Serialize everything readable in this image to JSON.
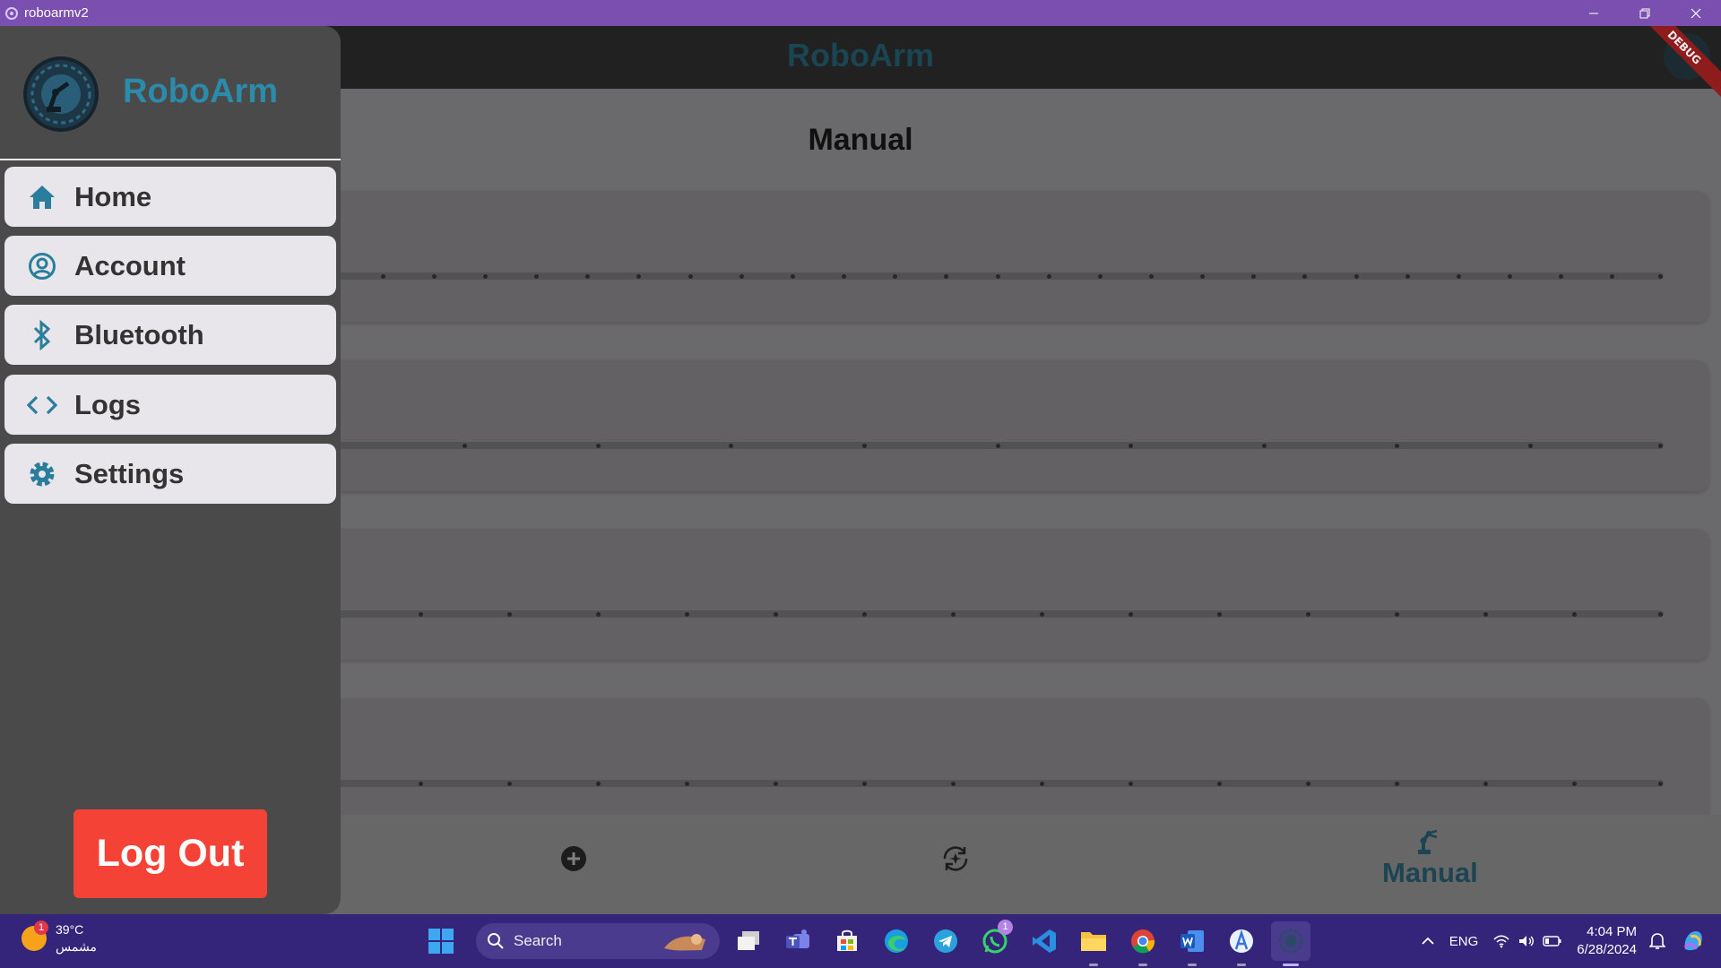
{
  "window": {
    "title": "roboarmv2"
  },
  "appbar": {
    "title": "RoboArm",
    "debug_label": "DEBUG"
  },
  "page": {
    "title": "Manual"
  },
  "sliders": [
    {
      "divisions": 26
    },
    {
      "divisions": 10
    },
    {
      "divisions": 15
    },
    {
      "divisions": 15
    }
  ],
  "bottom_nav": {
    "items": [
      {
        "icon": "add-circle-icon",
        "label": ""
      },
      {
        "icon": "rotate-icon",
        "label": ""
      },
      {
        "icon": "robot-arm-icon",
        "label": "Manual",
        "selected": true
      }
    ]
  },
  "drawer": {
    "title": "RoboArm",
    "items": [
      {
        "label": "Home",
        "icon": "home-icon"
      },
      {
        "label": "Account",
        "icon": "account-circle-icon"
      },
      {
        "label": "Bluetooth",
        "icon": "bluetooth-icon"
      },
      {
        "label": "Logs",
        "icon": "code-icon"
      },
      {
        "label": "Settings",
        "icon": "gear-icon"
      }
    ],
    "logout_label": "Log Out"
  },
  "taskbar": {
    "weather": {
      "temp": "39°C",
      "condition": "مشمس",
      "badge": "1"
    },
    "search_placeholder": "Search",
    "whatsapp_badge": "1",
    "language": "ENG",
    "time": "4:04 PM",
    "date": "6/28/2024"
  },
  "colors": {
    "accent": "#2a8bab",
    "titlebar": "#7b4faf",
    "logout": "#f44336",
    "taskbar": "#35257a"
  }
}
